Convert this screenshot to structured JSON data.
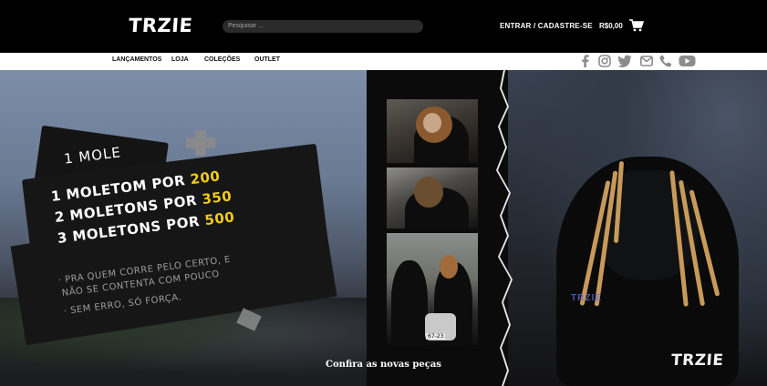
{
  "header": {
    "logo": "TRZIE",
    "search_placeholder": "Pesquisar ...",
    "login_label": "ENTRAR / CADASTRE-SE",
    "cart_total": "R$0,00",
    "cart_icon": "cart-icon"
  },
  "nav": {
    "items": [
      {
        "label": "LANÇAMENTOS"
      },
      {
        "label": "LOJA"
      },
      {
        "label": "COLEÇÕES"
      },
      {
        "label": "OUTLET"
      }
    ],
    "social_icons": [
      "facebook-icon",
      "instagram-icon",
      "twitter-icon",
      "email-icon",
      "phone-icon",
      "youtube-icon"
    ]
  },
  "hero": {
    "offer_partial": "1 MOLE",
    "offers": [
      {
        "qty": "1",
        "text": "MOLETOM POR",
        "price": "200"
      },
      {
        "qty": "2",
        "text": "MOLETONS POR",
        "price": "350"
      },
      {
        "qty": "3",
        "text": "MOLETONS POR",
        "price": "500"
      }
    ],
    "tagline_lines": [
      "· PRA QUEM CORRE PELO CERTO, E",
      "NÃO SE CONTENTA COM POUCO",
      "· SEM ERRO, SÓ FORÇA."
    ],
    "plate_text": "67-23",
    "shirt_print": "TRZIE",
    "caption": "Confira as novas peças",
    "logo": "TRZIE"
  },
  "colors": {
    "accent_yellow": "#f1cb1a",
    "header_bg": "#000000",
    "nav_bg": "#ffffff",
    "icon_gray": "#8c8c8c"
  }
}
